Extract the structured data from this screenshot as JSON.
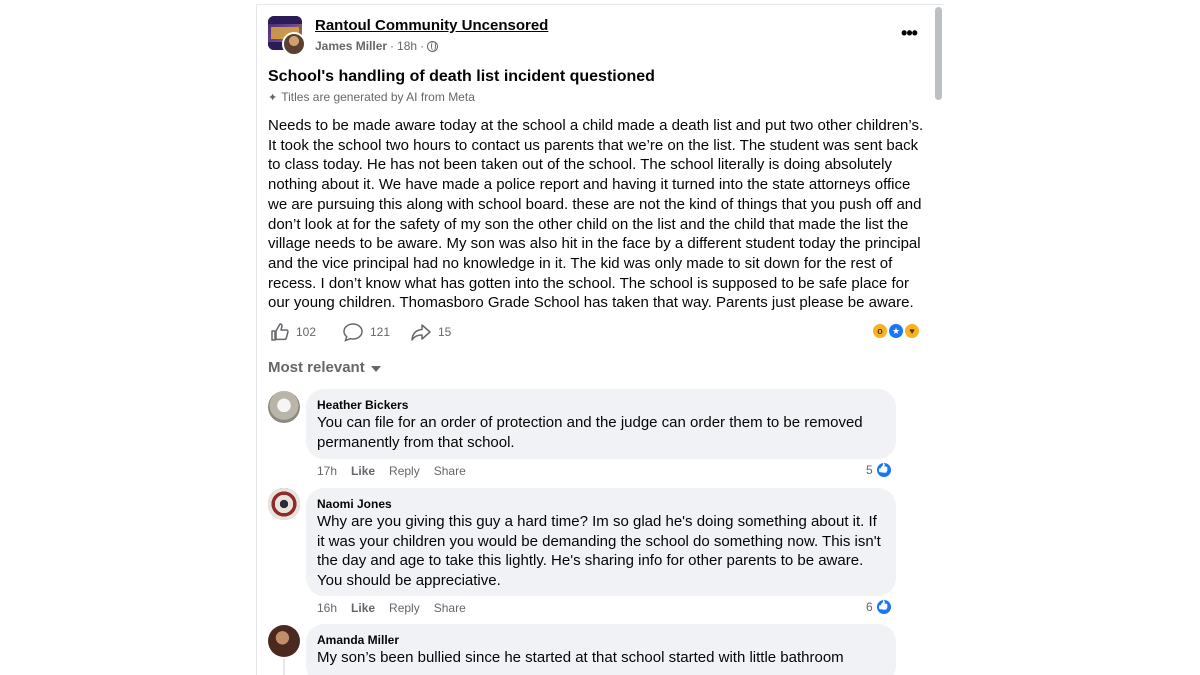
{
  "post": {
    "group_name": "Rantoul Community Uncensored",
    "author": "James Miller",
    "time": "18h",
    "separator": "·",
    "title": "School's handling of death list incident questioned",
    "ai_note": "Titles are generated by AI from Meta",
    "body": "Needs to be made aware today at the school a child made a death list and put two other children’s. It took the school two hours to contact us parents that we’re on the list. The student was sent back to class today. He has not been taken out of the school. The school literally is doing absolutely nothing about it. We have made a police report and having it turned into the state attorneys office we are pursuing this along with school board. these are not the kind of things that you push off and don’t look at for the safety of my son the other child on the list and the child that made the list the village needs to be aware. My son was also hit in the face by a different student today the principal and the vice principal had no knowledge in it. The kid was only made to sit down for the rest of recess. I don’t know what has gotten into the school. The school is supposed to be safe place for our young children. Thomasboro Grade School has taken that way. Parents just please be aware.",
    "likes": "102",
    "comments": "121",
    "shares": "15",
    "reactions": [
      "wow",
      "like",
      "care"
    ]
  },
  "sort_label": "Most relevant",
  "comments": [
    {
      "author": "Heather Bickers",
      "text": "You can file for an order of protection and the judge can order them to be removed permanently from that school.",
      "time": "17h",
      "like": "Like",
      "reply": "Reply",
      "share": "Share",
      "reaction_count": "5"
    },
    {
      "author": "Naomi Jones",
      "text": "Why are you giving this guy a hard time? Im so glad he's doing something about it. If it was your children you would be demanding the school do something now. This isn't the day and age to take this lightly. He's sharing info for other parents to be aware. You should be appreciative.",
      "time": "16h",
      "like": "Like",
      "reply": "Reply",
      "share": "Share",
      "reaction_count": "6"
    },
    {
      "author": "Amanda Miller",
      "text": "My son’s been bullied since he started at that school started with little bathroom"
    }
  ],
  "colors": {
    "text": "#050505",
    "secondary": "#65676b",
    "bubble": "#f0f2f5",
    "accent": "#1877f2"
  }
}
